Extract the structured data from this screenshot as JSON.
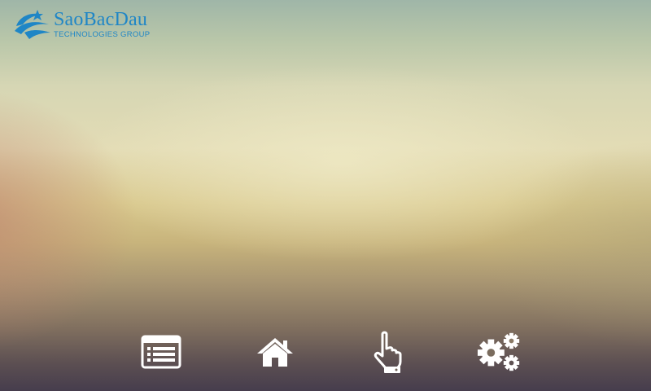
{
  "brand": {
    "name": "SaoBacDau",
    "subtitle": "TECHNOLOGIES GROUP",
    "logo_icon": "saobacdau-logo-icon",
    "color": "#1f86c6"
  },
  "toolbar": {
    "items": [
      {
        "id": "list",
        "icon": "list-icon",
        "name": "list-button"
      },
      {
        "id": "home",
        "icon": "home-icon",
        "name": "home-button"
      },
      {
        "id": "touch",
        "icon": "touch-hand-icon",
        "name": "touch-button"
      },
      {
        "id": "settings",
        "icon": "gears-icon",
        "name": "settings-button"
      }
    ],
    "icon_color": "#ffffff"
  }
}
